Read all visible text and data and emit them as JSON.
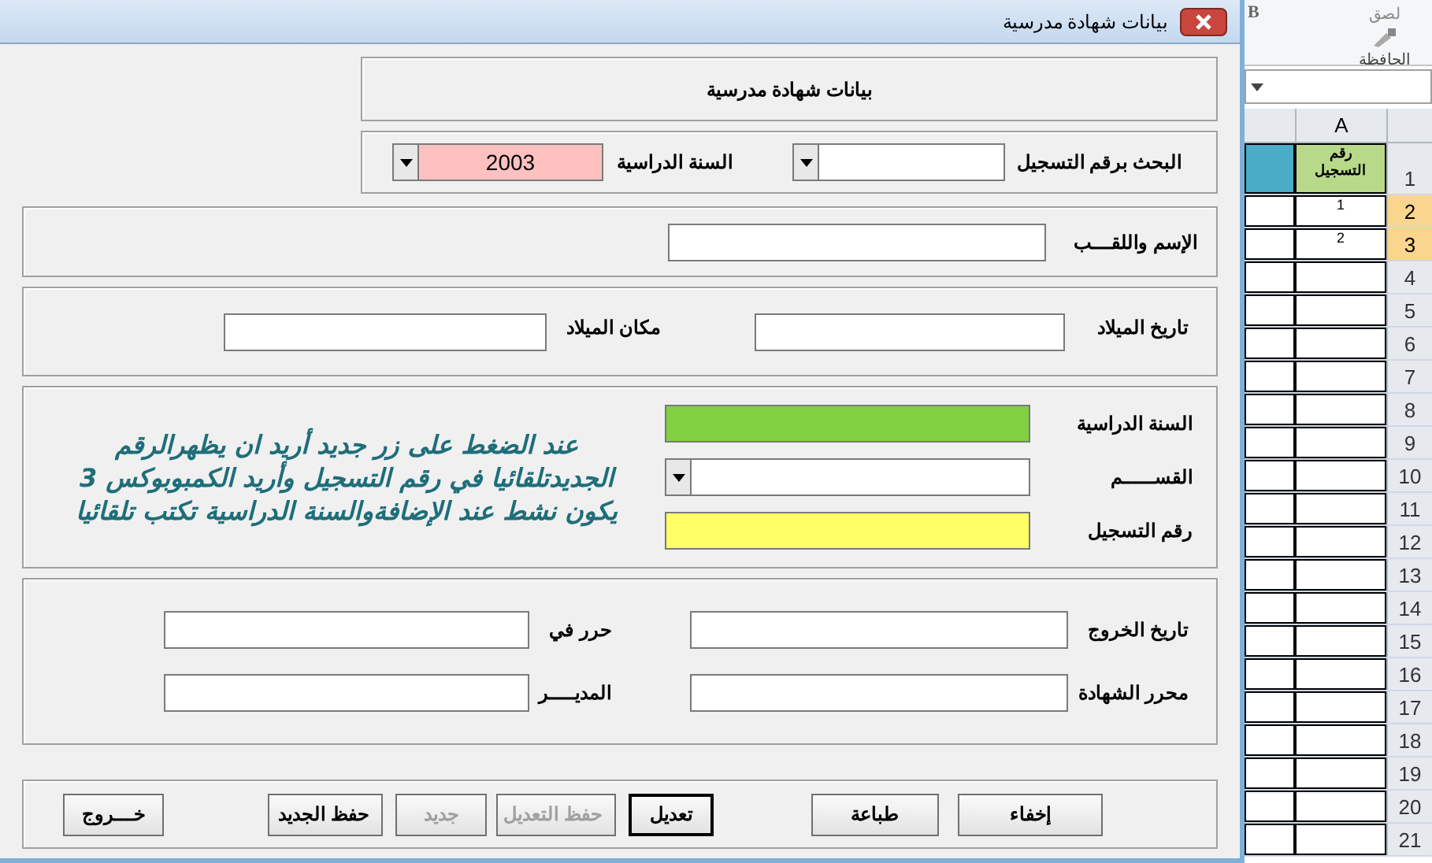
{
  "window": {
    "title": "بيانات شهادة مدرسية"
  },
  "header": {
    "title": "بيانات شهادة مدرسية"
  },
  "search": {
    "fields": [
      {
        "label": "البحث برقم التسجيل",
        "color": "#ffffff"
      },
      {
        "label": "السنة الدراسية",
        "value": "2003",
        "color": "#ffc0c0"
      }
    ]
  },
  "identity": {
    "label": "الإسم واللقـــب"
  },
  "birth": [
    {
      "label": "تاريخ الميلاد"
    },
    {
      "label": "مكان الميلاد"
    }
  ],
  "study": {
    "fields": [
      {
        "label": "السنة الدراسية",
        "kind": "text",
        "color": "#80d040"
      },
      {
        "label": "القســـــم",
        "kind": "combo",
        "color": "#ffffff"
      },
      {
        "label": "رقم التسجيل",
        "kind": "text",
        "color": "#ffff66"
      }
    ],
    "note": "عند الضغط على زر جديد أريد ان يظهرالرقم الجديدتلقائيا في رقم التسجيل وأريد الكمبوبوكس 3 يكون نشط عند الإضافةوالسنة الدراسية تكتب تلقائيا"
  },
  "exit": {
    "rows": [
      [
        {
          "label": "تاريخ الخروج"
        },
        {
          "label": "حرر في"
        }
      ],
      [
        {
          "label": "محرر الشهادة"
        },
        {
          "label": "المديــــر"
        }
      ]
    ]
  },
  "buttons": [
    {
      "label": "إخفاء",
      "disabled": false,
      "default": false
    },
    {
      "label": "طباعة",
      "disabled": false,
      "default": false
    },
    {
      "label": "تعديل",
      "disabled": false,
      "default": true
    },
    {
      "label": "حفظ التعديل",
      "disabled": true,
      "default": false
    },
    {
      "label": "جديد",
      "disabled": true,
      "default": false
    },
    {
      "label": "حفظ الجديد",
      "disabled": false,
      "default": false
    },
    {
      "label": "خـــروج",
      "disabled": false,
      "default": false
    }
  ],
  "sheet": {
    "ribbon": {
      "bold": "B",
      "paste": "لصق",
      "group": "الحافظة"
    },
    "column": "A",
    "rows": [
      {
        "number": "1",
        "value": "رقم التسجيل",
        "selected": false
      },
      {
        "number": "2",
        "value": "1",
        "selected": true
      },
      {
        "number": "3",
        "value": "2",
        "selected": true
      },
      {
        "number": "4",
        "selected": false
      },
      {
        "number": "5",
        "selected": false
      },
      {
        "number": "6",
        "selected": false
      },
      {
        "number": "7",
        "selected": false
      },
      {
        "number": "8",
        "selected": false
      },
      {
        "number": "9",
        "selected": false
      },
      {
        "number": "10",
        "selected": false
      },
      {
        "number": "11",
        "selected": false
      },
      {
        "number": "12",
        "selected": false
      },
      {
        "number": "13",
        "selected": false
      },
      {
        "number": "14",
        "selected": false
      },
      {
        "number": "15",
        "selected": false
      },
      {
        "number": "16",
        "selected": false
      },
      {
        "number": "17",
        "selected": false
      },
      {
        "number": "18",
        "selected": false
      },
      {
        "number": "19",
        "selected": false
      },
      {
        "number": "20",
        "selected": false
      },
      {
        "number": "21",
        "selected": false
      }
    ]
  }
}
